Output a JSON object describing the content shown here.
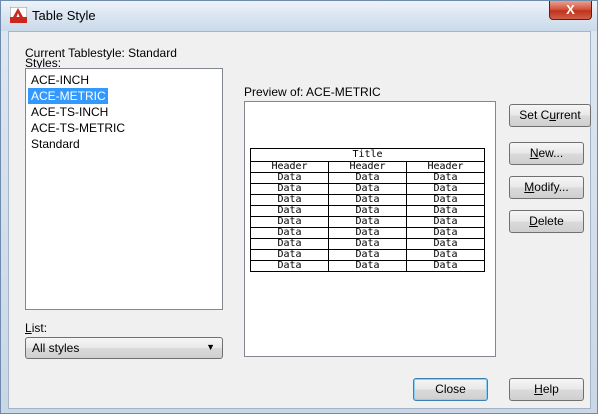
{
  "window": {
    "title": "Table Style",
    "close_label": "X"
  },
  "current_tablestyle_label": "Current Tablestyle: Standard",
  "styles": {
    "label_mnemonic": "S",
    "label_rest": "tyles:",
    "items": [
      "ACE-INCH",
      "ACE-METRIC",
      "ACE-TS-INCH",
      "ACE-TS-METRIC",
      "Standard"
    ],
    "selected_index": 1
  },
  "preview": {
    "label": "Preview of: ACE-METRIC",
    "table_title": "Title",
    "headers": [
      "Header",
      "Header",
      "Header"
    ],
    "data_rows": [
      [
        "Data",
        "Data",
        "Data"
      ],
      [
        "Data",
        "Data",
        "Data"
      ],
      [
        "Data",
        "Data",
        "Data"
      ],
      [
        "Data",
        "Data",
        "Data"
      ],
      [
        "Data",
        "Data",
        "Data"
      ],
      [
        "Data",
        "Data",
        "Data"
      ],
      [
        "Data",
        "Data",
        "Data"
      ],
      [
        "Data",
        "Data",
        "Data"
      ],
      [
        "Data",
        "Data",
        "Data"
      ]
    ]
  },
  "buttons": {
    "set_current": {
      "pre": "Set C",
      "mnemonic": "u",
      "post": "rrent"
    },
    "new": {
      "pre": "",
      "mnemonic": "N",
      "post": "ew..."
    },
    "modify": {
      "pre": "",
      "mnemonic": "M",
      "post": "odify..."
    },
    "delete": {
      "pre": "",
      "mnemonic": "D",
      "post": "elete"
    },
    "close": {
      "label": "Close"
    },
    "help": {
      "pre": "",
      "mnemonic": "H",
      "post": "elp"
    }
  },
  "list_filter": {
    "label_mnemonic": "L",
    "label_rest": "ist:",
    "selected_value": "All styles"
  },
  "colors": {
    "selection": "#3399ff",
    "close_button": "#c0321b"
  }
}
